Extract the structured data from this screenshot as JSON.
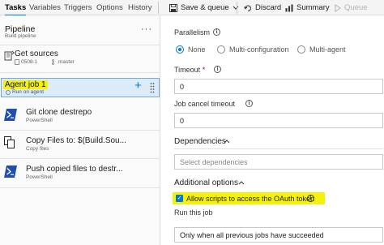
{
  "tabs": [
    {
      "label": "Tasks",
      "active": true
    },
    {
      "label": "Variables"
    },
    {
      "label": "Triggers"
    },
    {
      "label": "Options"
    },
    {
      "label": "History"
    }
  ],
  "toolbar": {
    "save_label": "Save & queue",
    "discard_label": "Discard",
    "summary_label": "Summary",
    "queue_label": "Queue"
  },
  "left": {
    "pipeline_title": "Pipeline",
    "pipeline_sub": "Build pipeline",
    "more": "···",
    "get_sources": {
      "title": "Get sources",
      "repo": "0508-1",
      "branch": "master"
    },
    "agent_job": {
      "title": "Agent job 1",
      "sub": "Run on agent",
      "add": "+"
    },
    "tasks": [
      {
        "title": "Git clone destrepo",
        "sub": "PowerShell",
        "icon": "powershell-icon"
      },
      {
        "title": "Copy Files to: $(Build.Sou...",
        "sub": "Copy files",
        "icon": "copy-files-icon"
      },
      {
        "title": "Push copied files to destr...",
        "sub": "PowerShell",
        "icon": "powershell-icon"
      }
    ]
  },
  "right": {
    "parallelism_label": "Parallelism",
    "radio_none": "None",
    "radio_multi_config": "Multi-configuration",
    "radio_multi_agent": "Multi-agent",
    "timeout_label": "Timeout",
    "timeout_value": "0",
    "cancel_timeout_label": "Job cancel timeout",
    "cancel_timeout_value": "0",
    "dependencies_label": "Dependencies",
    "dependencies_placeholder": "Select dependencies",
    "additional_label": "Additional options",
    "oauth_label": "Allow scripts to access the OAuth token",
    "run_this_job_label": "Run this job",
    "run_this_job_value": "Only when all previous jobs have succeeded"
  },
  "colors": {
    "accent": "#0078d4",
    "highlight": "#f4f20a",
    "powershell": "#1f4fa8"
  }
}
